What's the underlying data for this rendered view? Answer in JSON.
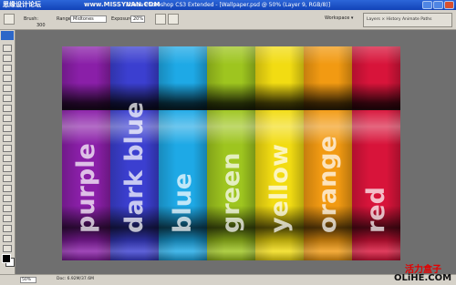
{
  "window": {
    "title": "Adobe Photoshop CS3 Extended - [Wallpaper.psd @ 50% (Layer 9, RGB/8)]",
    "watermark_left": "思缘设计论坛",
    "watermark_mid": "www.MISSYUAN.COM"
  },
  "options_bar": {
    "brush_label": "Brush:",
    "brush_size": "300",
    "range_label": "Range:",
    "range_value": "Midtones",
    "exposure_label": "Exposure:",
    "exposure_value": "20%",
    "workspace_label": "Workspace ▾",
    "panels_label": "Layers × History Animate Paths"
  },
  "canvas": {
    "colors": {
      "purple": "#8a1fa8",
      "dark_blue": "#3b3fd0",
      "blue": "#1ea9e6",
      "green": "#9ec51f",
      "yellow": "#f2dc12",
      "orange": "#f29a12",
      "red": "#d8143a"
    },
    "stripes": [
      {
        "label": "purple",
        "color": "#8a1fa8"
      },
      {
        "label": "dark blue",
        "color": "#3b3fd0"
      },
      {
        "label": "blue",
        "color": "#1ea9e6"
      },
      {
        "label": "green",
        "color": "#9ec51f"
      },
      {
        "label": "yellow",
        "color": "#f2dc12"
      },
      {
        "label": "orange",
        "color": "#f29a12"
      },
      {
        "label": "red",
        "color": "#d8143a"
      }
    ]
  },
  "status": {
    "zoom": "50%",
    "doc": "Doc: 6.92M/37.6M"
  },
  "branding": {
    "cn": "活力盒子",
    "en": "OLiHE.COM"
  }
}
